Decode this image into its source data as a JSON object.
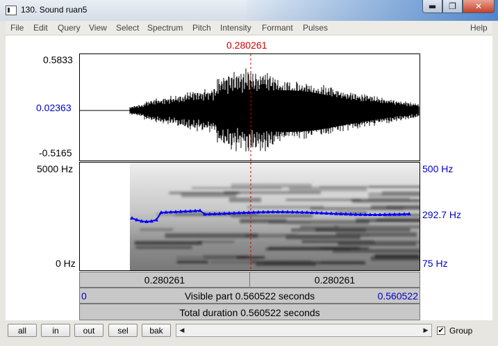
{
  "window": {
    "title": "130. Sound ruan5",
    "minimize": "▬",
    "maximize": "❐",
    "close": "✕"
  },
  "menu": [
    "File",
    "Edit",
    "Query",
    "View",
    "Select",
    "Spectrum",
    "Pitch",
    "Intensity",
    "Formant",
    "Pulses",
    "Help"
  ],
  "cursor": {
    "time_top": "0.280261"
  },
  "waveform": {
    "max_label": "0.5833",
    "cursor_value": "0.02363",
    "min_label": "-0.5165"
  },
  "spectrogram": {
    "top_freq": "5000 Hz",
    "bottom_freq": "0 Hz"
  },
  "pitch": {
    "top": "500 Hz",
    "value": "292.7 Hz",
    "bottom": "75 Hz",
    "color": "#0000ff"
  },
  "bars": {
    "left_time": "0.280261",
    "right_time": "0.280261",
    "visible_start": "0",
    "visible_text": "Visible part 0.560522 seconds",
    "visible_end": "0.560522",
    "total_text": "Total duration 0.560522 seconds"
  },
  "buttons": {
    "all": "all",
    "in": "in",
    "out": "out",
    "sel": "sel",
    "bak": "bak"
  },
  "scroll": {
    "left_arrow": "◀",
    "right_arrow": "▶"
  },
  "group": {
    "label": "Group",
    "checked": true,
    "check_mark": "✔"
  }
}
